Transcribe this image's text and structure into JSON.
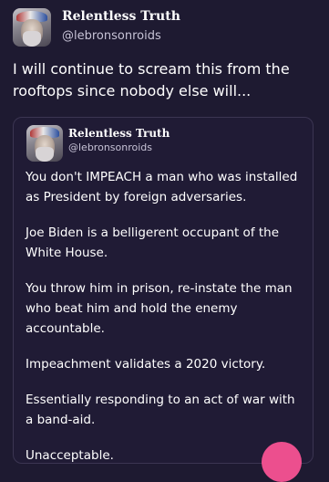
{
  "post": {
    "author": {
      "name": "Relentless Truth",
      "handle": "@lebronsonroids"
    },
    "text": "I will continue to scream this from the rooftops since nobody else will...",
    "quote": {
      "author": {
        "name": "Relentless Truth",
        "handle": "@lebronsonroids"
      },
      "paragraphs": [
        "You don't IMPEACH a man who was installed as President by foreign adversaries.",
        "Joe Biden is a belligerent occupant of the White House.",
        "You throw him in prison, re-instate the man who beat him and hold the enemy accountable.",
        "Impeachment validates a 2020 victory.",
        "Essentially responding to an act of war with a band-aid.",
        "Unacceptable."
      ]
    }
  },
  "colors": {
    "background": "#1e1a31",
    "card_background": "#201b35",
    "card_border": "#3b3552",
    "accent_fab": "#ec4f8e",
    "text": "#ffffff",
    "muted_text": "#c7c3d6"
  }
}
